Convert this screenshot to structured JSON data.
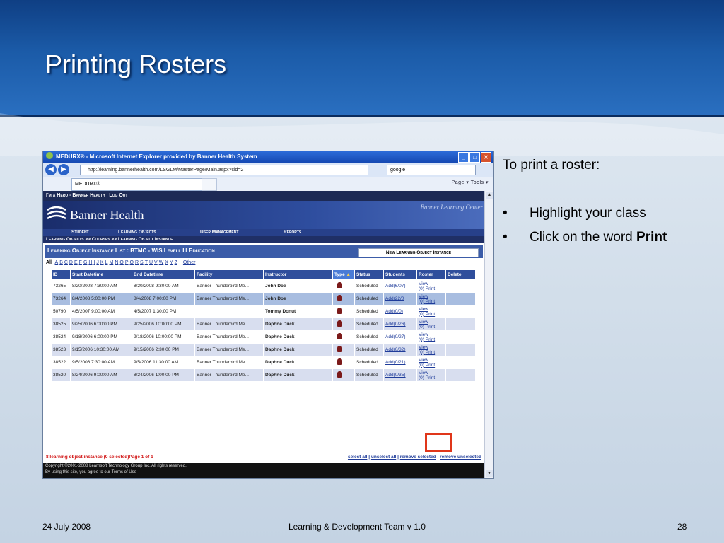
{
  "slide": {
    "title": "Printing Rosters",
    "footer_date": "24 July 2008",
    "footer_center": "Learning & Development Team v 1.0",
    "footer_page": "28"
  },
  "instructions": {
    "intro": "To print a roster:",
    "bullets": [
      {
        "text": "Highlight your class",
        "bold": ""
      },
      {
        "text": "Click on the word ",
        "bold": "Print"
      }
    ]
  },
  "browser": {
    "window_title": "MEDURX® - Microsoft Internet Explorer provided by Banner Health System",
    "url": "http://learning.bannerhealth.com/LSGLM/MasterPage/Main.aspx?cid=2",
    "search_value": "google",
    "tab_label": "MEDURX®",
    "toolbar_tools": "Page ▾  Tools ▾"
  },
  "app": {
    "hero_bar": "I'm a Hero - Banner Health | Log Out",
    "brand": "Banner Health",
    "brand_tagline": "Banner Learning Center",
    "menu": [
      "Student",
      "Learning Objects",
      "User Management",
      "Reports"
    ],
    "breadcrumb": "Learning Objects >> Courses >> Learning Object Instance",
    "list_title": "Learning Object Instance List : BTMC - WIS Levell III Education",
    "new_button": "New Learning Object Instance",
    "alpha_all": "All",
    "alpha_letters": [
      "A",
      "B",
      "C",
      "D",
      "E",
      "F",
      "G",
      "H",
      "I",
      "J",
      "K",
      "L",
      "M",
      "N",
      "O",
      "P",
      "Q",
      "R",
      "S",
      "T",
      "U",
      "V",
      "W",
      "X",
      "Y",
      "Z"
    ],
    "alpha_other": "Other",
    "columns": [
      "ID",
      "Start Datetime",
      "End Datetime",
      "Facility",
      "Instructor",
      "Type",
      "Status",
      "Students",
      "Roster",
      "Delete"
    ],
    "type_sort_indicator": "▲",
    "roster_view": "View",
    "roster_count": "(0)",
    "roster_print": "Print",
    "rows": [
      {
        "id": "73265",
        "start": "8/20/2008 7:30:00 AM",
        "end": "8/20/2008 9:30:00 AM",
        "facility": "Banner Thunderbird Me...",
        "instructor": "John Doe",
        "status": "Scheduled",
        "students": "Add(6/07)"
      },
      {
        "id": "73264",
        "start": "8/4/2008 5:00:00 PM",
        "end": "8/4/2008 7:00:00 PM",
        "facility": "Banner Thunderbird Me...",
        "instructor": "John Doe",
        "status": "Scheduled",
        "students": "Add(22/0"
      },
      {
        "id": "50790",
        "start": "4/5/2007 9:00:00 AM",
        "end": "4/5/2007 1:30:00 PM",
        "facility": "",
        "instructor": "Tommy Donut",
        "status": "Scheduled",
        "students": "Add(0/0)"
      },
      {
        "id": "38525",
        "start": "9/25/2006 6:00:00 PM",
        "end": "9/25/2006 10:00:00 PM",
        "facility": "Banner Thunderbird Me...",
        "instructor": "Daphne Duck",
        "status": "Scheduled",
        "students": "Add(0/26)"
      },
      {
        "id": "38524",
        "start": "9/18/2006 6:00:00 PM",
        "end": "9/18/2006 10:00:00 PM",
        "facility": "Banner Thunderbird Me...",
        "instructor": "Daphne Duck",
        "status": "Scheduled",
        "students": "Add(0/27)"
      },
      {
        "id": "38523",
        "start": "9/15/2006 10:30:00 AM",
        "end": "9/15/2006 2:30:00 PM",
        "facility": "Banner Thunderbird Me...",
        "instructor": "Daphne Duck",
        "status": "Scheduled",
        "students": "Add(0/32)"
      },
      {
        "id": "38522",
        "start": "9/5/2006 7:30:00 AM",
        "end": "9/5/2006 11:30:00 AM",
        "facility": "Banner Thunderbird Me...",
        "instructor": "Daphne Duck",
        "status": "Scheduled",
        "students": "Add(0/21)"
      },
      {
        "id": "38520",
        "start": "8/24/2006 9:00:00 AM",
        "end": "8/24/2006 1:00:00 PM",
        "facility": "Banner Thunderbird Me...",
        "instructor": "Daphne Duck",
        "status": "Scheduled",
        "students": "Add(0/35)"
      }
    ],
    "selection_summary": "8 learning object instance (0 selected)Page 1 of 1",
    "selection_links": [
      "select all",
      "unselect all",
      "remove selected",
      "remove unselected"
    ],
    "copyright": "Copyright ©2001-2008 Learnsoft Technology Group Inc. All rights reserved.",
    "copyright_line2": "By using this site, you agree to our Terms of Use"
  },
  "colors": {
    "slide_header": "#1b5ba8",
    "highlight": "#e0361a",
    "app_navy": "#1d2a55"
  }
}
